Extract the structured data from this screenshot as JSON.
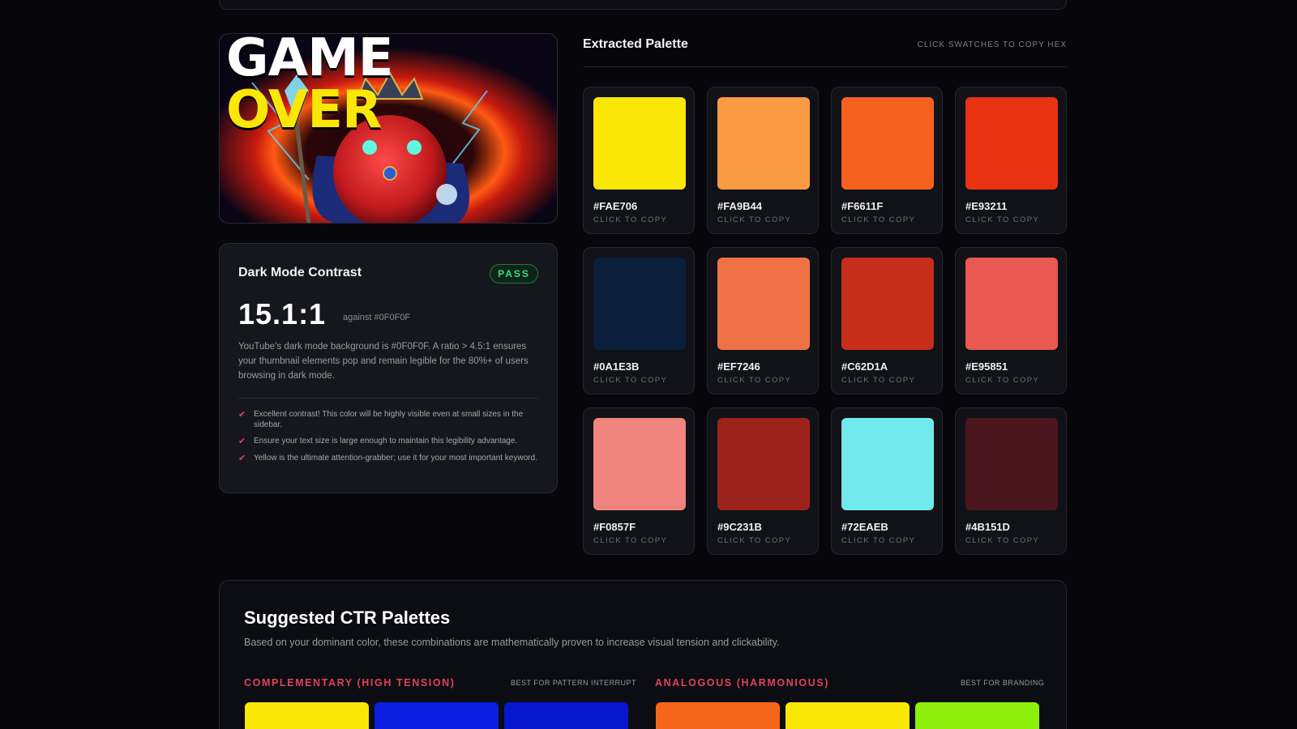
{
  "thumbnail": {
    "title_white": "GAME",
    "title_yellow": "OVER"
  },
  "contrast": {
    "title": "Dark Mode Contrast",
    "badge": "PASS",
    "ratio": "15.1:1",
    "against": "against #0F0F0F",
    "description": "YouTube's dark mode background is #0F0F0F. A ratio > 4.5:1 ensures your thumbnail elements pop and remain legible for the 80%+ of users browsing in dark mode.",
    "tips": [
      "Excellent contrast! This color will be highly visible even at small sizes in the sidebar.",
      "Ensure your text size is large enough to maintain this legibility advantage.",
      "Yellow is the ultimate attention-grabber; use it for your most important keyword."
    ]
  },
  "palette": {
    "title": "Extracted Palette",
    "hint": "CLICK SWATCHES TO COPY HEX",
    "copy_label": "CLICK TO COPY",
    "swatches": [
      {
        "hex": "#FAE706",
        "color": "#fae706"
      },
      {
        "hex": "#FA9B44",
        "color": "#fa9b44"
      },
      {
        "hex": "#F6611F",
        "color": "#f6611f"
      },
      {
        "hex": "#E93211",
        "color": "#e93211"
      },
      {
        "hex": "#0A1E3B",
        "color": "#0a1e3b"
      },
      {
        "hex": "#EF7246",
        "color": "#ef7246"
      },
      {
        "hex": "#C62D1A",
        "color": "#c62d1a"
      },
      {
        "hex": "#E95851",
        "color": "#e95851"
      },
      {
        "hex": "#F0857F",
        "color": "#f0857f"
      },
      {
        "hex": "#9C231B",
        "color": "#9c231b"
      },
      {
        "hex": "#72EAEB",
        "color": "#72eaeb"
      },
      {
        "hex": "#4B151D",
        "color": "#4b151d"
      }
    ]
  },
  "suggested": {
    "title": "Suggested CTR Palettes",
    "description": "Based on your dominant color, these combinations are mathematically proven to increase visual tension and clickability.",
    "groups": [
      {
        "title": "COMPLEMENTARY (HIGH TENSION)",
        "note": "BEST FOR PATTERN INTERRUPT",
        "colors": [
          "#fae706",
          "#0a1fe0",
          "#0716cf"
        ]
      },
      {
        "title": "ANALOGOUS (HARMONIOUS)",
        "note": "BEST FOR BRANDING",
        "colors": [
          "#f6661a",
          "#fae706",
          "#8ef00a"
        ]
      }
    ]
  },
  "colors": {
    "accent": "#e0415c",
    "pass_green": "#3ddc7a",
    "background": "#07070b"
  }
}
